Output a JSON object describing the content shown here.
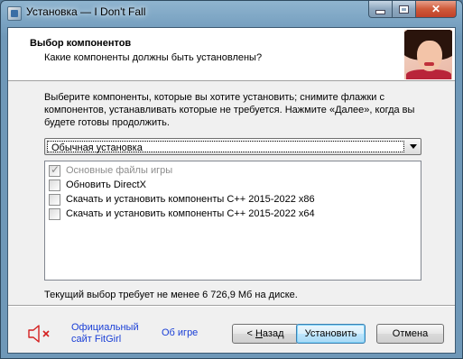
{
  "window": {
    "title": "Установка — I Don't Fall"
  },
  "header": {
    "title": "Выбор компонентов",
    "subtitle": "Какие компоненты должны быть установлены?"
  },
  "description": "Выберите компоненты, которые вы хотите установить; снимите флажки с компонентов, устанавливать которые не требуется. Нажмите «Далее», когда вы будете готовы продолжить.",
  "install_type": {
    "selected": "Обычная установка"
  },
  "components": [
    {
      "label": "Основные файлы игры",
      "checked": true,
      "disabled": true
    },
    {
      "label": "Обновить DirectX",
      "checked": false,
      "disabled": false
    },
    {
      "label": "Скачать и установить компоненты C++ 2015-2022 x86",
      "checked": false,
      "disabled": false
    },
    {
      "label": "Скачать и установить компоненты C++ 2015-2022 x64",
      "checked": false,
      "disabled": false
    }
  ],
  "disk_requirement": "Текущий выбор требует не менее 6 726,9 Мб на диске.",
  "links": {
    "official_site_line1": "Официальный",
    "official_site_line2": "сайт FitGirl",
    "about_game": "Об игре"
  },
  "buttons": {
    "back_prefix": "< ",
    "back_underlined": "Н",
    "back_rest": "азад",
    "install": "Установить",
    "cancel": "Отмена"
  },
  "colors": {
    "link": "#1a3fd6",
    "mute_icon_red": "#d42020"
  },
  "icons": [
    "app-icon",
    "minimize-icon",
    "maximize-icon",
    "close-icon",
    "speaker-muted-icon",
    "dropdown-arrow-icon"
  ]
}
